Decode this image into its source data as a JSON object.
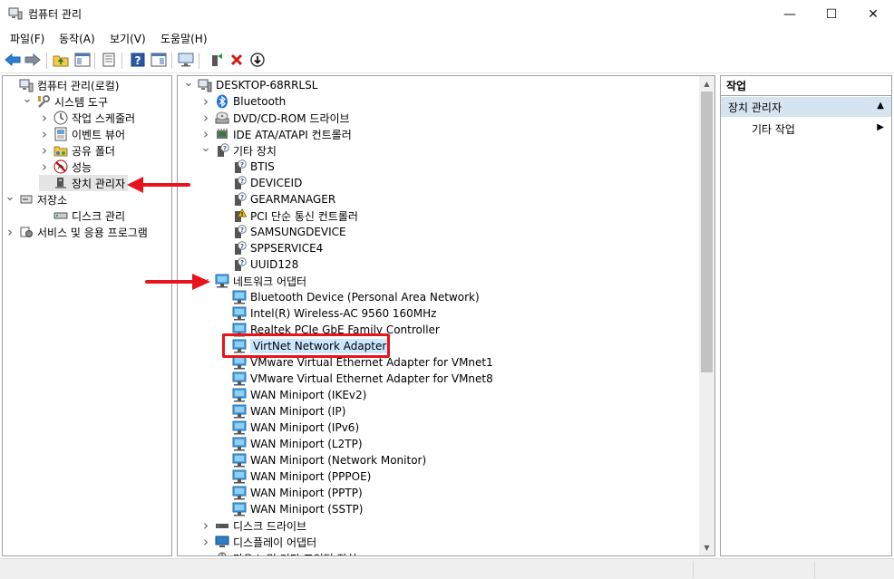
{
  "window": {
    "title": "컴퓨터 관리",
    "minimize": "—",
    "maximize": "☐",
    "close": "✕"
  },
  "menu": [
    "파일(F)",
    "동작(A)",
    "보기(V)",
    "도움말(H)"
  ],
  "toolbar_icons": [
    "back-icon",
    "forward-icon",
    "up-folder-icon",
    "show-hide-tree-icon",
    "properties-icon",
    "help-icon",
    "help-pane-icon",
    "monitor-icon",
    "enable-device-icon",
    "uninstall-icon",
    "update-driver-icon"
  ],
  "left_tree": [
    {
      "label": "컴퓨터 관리(로컬)",
      "level": 0,
      "exp": "",
      "icon": "computer-management-icon"
    },
    {
      "label": "시스템 도구",
      "level": 1,
      "exp": "v",
      "icon": "system-tools-icon"
    },
    {
      "label": "작업 스케줄러",
      "level": 2,
      "exp": ">",
      "icon": "clock-icon"
    },
    {
      "label": "이벤트 뷰어",
      "level": 2,
      "exp": ">",
      "icon": "event-viewer-icon"
    },
    {
      "label": "공유 폴더",
      "level": 2,
      "exp": ">",
      "icon": "shared-folder-icon"
    },
    {
      "label": "성능",
      "level": 2,
      "exp": ">",
      "icon": "performance-icon"
    },
    {
      "label": "장치 관리자",
      "level": 2,
      "exp": "",
      "icon": "device-manager-icon",
      "selected": true
    },
    {
      "label": "저장소",
      "level": 0,
      "exp": "v",
      "icon": "storage-icon"
    },
    {
      "label": "디스크 관리",
      "level": 2,
      "exp": "",
      "icon": "disk-management-icon"
    },
    {
      "label": "서비스 및 응용 프로그램",
      "level": 0,
      "exp": ">",
      "icon": "services-icon"
    }
  ],
  "device_tree": [
    {
      "label": "DESKTOP-68RRLSL",
      "level": 0,
      "exp": "v",
      "icon": "computer-icon"
    },
    {
      "label": "Bluetooth",
      "level": 1,
      "exp": ">",
      "icon": "bluetooth-icon"
    },
    {
      "label": "DVD/CD-ROM 드라이브",
      "level": 1,
      "exp": ">",
      "icon": "dvd-drive-icon"
    },
    {
      "label": "IDE ATA/ATAPI 컨트롤러",
      "level": 1,
      "exp": ">",
      "icon": "ide-controller-icon"
    },
    {
      "label": "기타 장치",
      "level": 1,
      "exp": "v",
      "icon": "unknown-device-icon"
    },
    {
      "label": "BTIS",
      "level": 2,
      "exp": "",
      "icon": "unknown-device-icon"
    },
    {
      "label": "DEVICEID",
      "level": 2,
      "exp": "",
      "icon": "unknown-device-icon"
    },
    {
      "label": "GEARMANAGER",
      "level": 2,
      "exp": "",
      "icon": "unknown-device-icon"
    },
    {
      "label": "PCI 단순 통신 컨트롤러",
      "level": 2,
      "exp": "",
      "icon": "warning-device-icon"
    },
    {
      "label": "SAMSUNGDEVICE",
      "level": 2,
      "exp": "",
      "icon": "unknown-device-icon"
    },
    {
      "label": "SPPSERVICE4",
      "level": 2,
      "exp": "",
      "icon": "unknown-device-icon"
    },
    {
      "label": "UUID128",
      "level": 2,
      "exp": "",
      "icon": "unknown-device-icon"
    },
    {
      "label": "네트워크 어댑터",
      "level": 1,
      "exp": "v",
      "icon": "network-adapter-icon"
    },
    {
      "label": "Bluetooth Device (Personal Area Network)",
      "level": 2,
      "exp": "",
      "icon": "network-adapter-icon"
    },
    {
      "label": "Intel(R) Wireless-AC 9560 160MHz",
      "level": 2,
      "exp": "",
      "icon": "network-adapter-icon"
    },
    {
      "label": "Realtek PCIe GbE Family Controller",
      "level": 2,
      "exp": "",
      "icon": "network-adapter-icon"
    },
    {
      "label": "VirtNet Network Adapter",
      "level": 2,
      "exp": "",
      "icon": "network-adapter-icon",
      "highlight": true
    },
    {
      "label": "VMware Virtual Ethernet Adapter for VMnet1",
      "level": 2,
      "exp": "",
      "icon": "network-adapter-icon"
    },
    {
      "label": "VMware Virtual Ethernet Adapter for VMnet8",
      "level": 2,
      "exp": "",
      "icon": "network-adapter-icon"
    },
    {
      "label": "WAN Miniport (IKEv2)",
      "level": 2,
      "exp": "",
      "icon": "network-adapter-icon"
    },
    {
      "label": "WAN Miniport (IP)",
      "level": 2,
      "exp": "",
      "icon": "network-adapter-icon"
    },
    {
      "label": "WAN Miniport (IPv6)",
      "level": 2,
      "exp": "",
      "icon": "network-adapter-icon"
    },
    {
      "label": "WAN Miniport (L2TP)",
      "level": 2,
      "exp": "",
      "icon": "network-adapter-icon"
    },
    {
      "label": "WAN Miniport (Network Monitor)",
      "level": 2,
      "exp": "",
      "icon": "network-adapter-icon"
    },
    {
      "label": "WAN Miniport (PPPOE)",
      "level": 2,
      "exp": "",
      "icon": "network-adapter-icon"
    },
    {
      "label": "WAN Miniport (PPTP)",
      "level": 2,
      "exp": "",
      "icon": "network-adapter-icon"
    },
    {
      "label": "WAN Miniport (SSTP)",
      "level": 2,
      "exp": "",
      "icon": "network-adapter-icon"
    },
    {
      "label": "디스크 드라이브",
      "level": 1,
      "exp": ">",
      "icon": "disk-drive-icon"
    },
    {
      "label": "디스플레이 어댑터",
      "level": 1,
      "exp": ">",
      "icon": "display-adapter-icon"
    },
    {
      "label": "마우스 및 기타 포인팅 장치",
      "level": 1,
      "exp": ">",
      "icon": "mouse-icon"
    }
  ],
  "actions": {
    "header": "작업",
    "section": "장치 관리자",
    "item": "기타 작업"
  },
  "colors": {
    "selection": "#e5e5e5",
    "highlight": "#cce8ff",
    "annotation": "#e8141d",
    "actions_section": "#d6e3f1"
  }
}
